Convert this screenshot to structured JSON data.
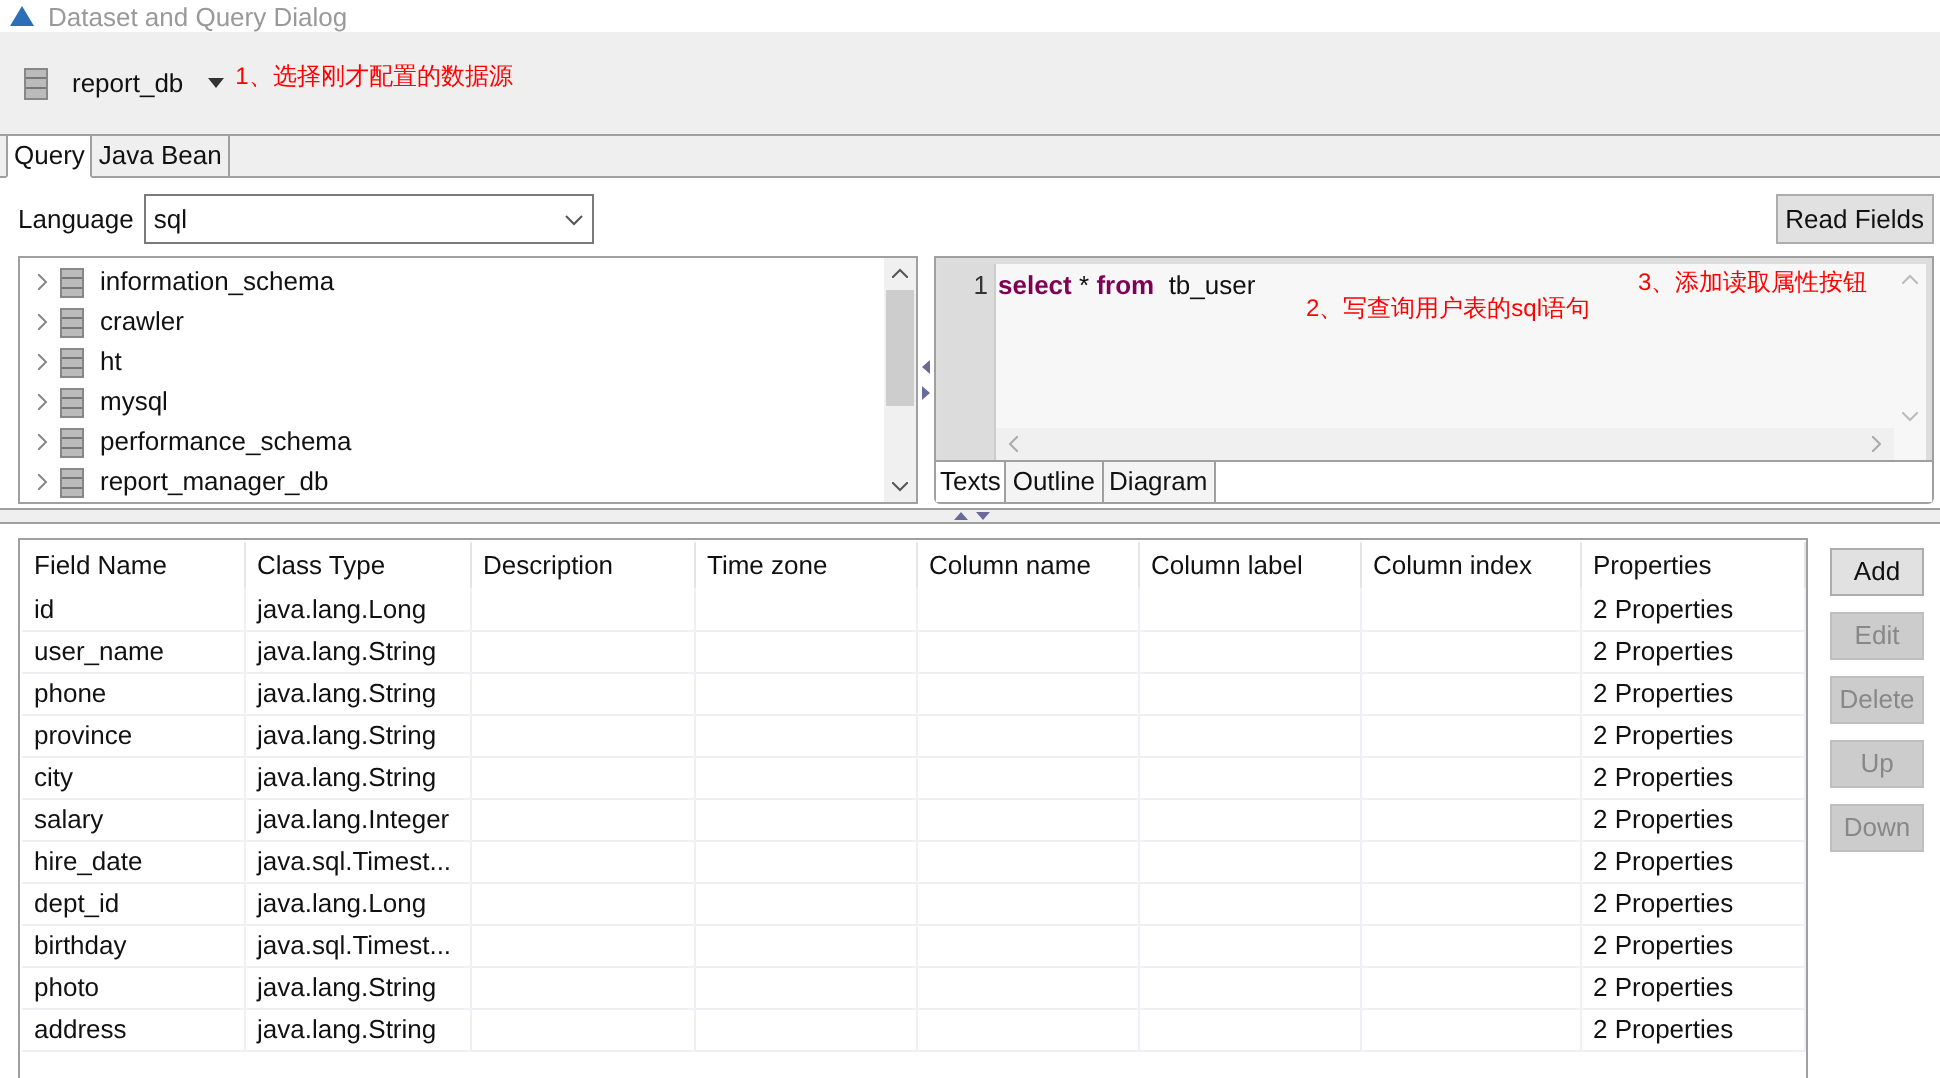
{
  "window": {
    "title": "Dataset and Query Dialog"
  },
  "data_source": {
    "value": "report_db",
    "note": "1、选择刚才配置的数据源"
  },
  "tabs": [
    {
      "label": "Query",
      "selected": true
    },
    {
      "label": "Java Bean",
      "selected": false
    }
  ],
  "language": {
    "label": "Language",
    "value": "sql"
  },
  "read_fields_button": "Read Fields",
  "schema_tree": [
    {
      "label": "information_schema"
    },
    {
      "label": "crawler"
    },
    {
      "label": "ht"
    },
    {
      "label": "mysql"
    },
    {
      "label": "performance_schema"
    },
    {
      "label": "report_manager_db"
    }
  ],
  "editor": {
    "line_number": "1",
    "tokens": [
      {
        "text": "select",
        "kind": "keyword"
      },
      {
        "text": "*",
        "kind": "plain"
      },
      {
        "text": "from",
        "kind": "keyword"
      },
      {
        "text": "tb_user",
        "kind": "plain"
      }
    ],
    "notes": [
      "2、写查询用户表的sql语句",
      "3、添加读取属性按钮"
    ],
    "tabs": [
      {
        "label": "Texts",
        "selected": true
      },
      {
        "label": "Outline",
        "selected": false
      },
      {
        "label": "Diagram",
        "selected": false
      }
    ]
  },
  "table": {
    "columns": [
      "Field Name",
      "Class Type",
      "Description",
      "Time zone",
      "Column name",
      "Column label",
      "Column index",
      "Properties"
    ],
    "rows": [
      [
        "id",
        "java.lang.Long",
        "2 Properties"
      ],
      [
        "user_name",
        "java.lang.String",
        "2 Properties"
      ],
      [
        "phone",
        "java.lang.String",
        "2 Properties"
      ],
      [
        "province",
        "java.lang.String",
        "2 Properties"
      ],
      [
        "city",
        "java.lang.String",
        "2 Properties"
      ],
      [
        "salary",
        "java.lang.Integer",
        "2 Properties"
      ],
      [
        "hire_date",
        "java.sql.Timest...",
        "2 Properties"
      ],
      [
        "dept_id",
        "java.lang.Long",
        "2 Properties"
      ],
      [
        "birthday",
        "java.sql.Timest...",
        "2 Properties"
      ],
      [
        "photo",
        "java.lang.String",
        "2 Properties"
      ],
      [
        "address",
        "java.lang.String",
        "2 Properties"
      ]
    ]
  },
  "side_buttons": [
    {
      "label": "Add",
      "disabled": false
    },
    {
      "label": "Edit",
      "disabled": true
    },
    {
      "label": "Delete",
      "disabled": true
    },
    {
      "label": "Up",
      "disabled": true
    },
    {
      "label": "Down",
      "disabled": true
    }
  ]
}
